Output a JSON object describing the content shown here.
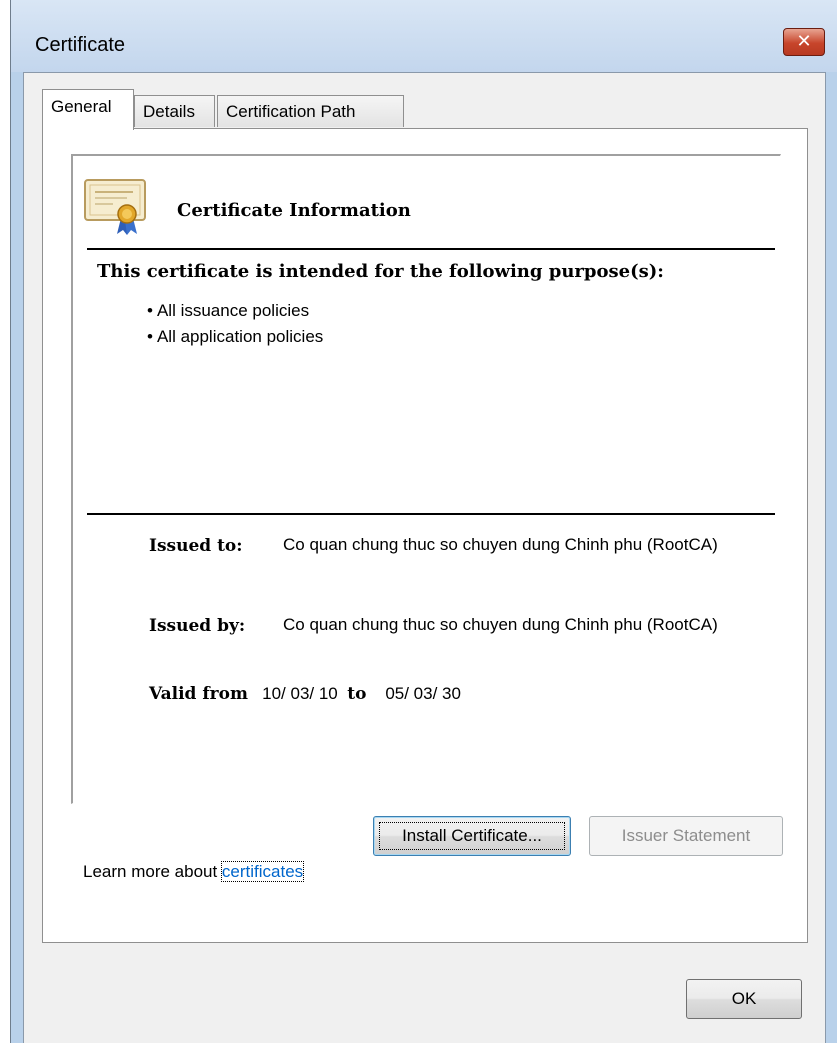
{
  "window": {
    "title": "Certificate",
    "close_glyph": "✕"
  },
  "tabs": [
    {
      "label": "General",
      "active": true
    },
    {
      "label": "Details",
      "active": false
    },
    {
      "label": "Certification Path",
      "active": false
    }
  ],
  "info": {
    "icon": "certificate-icon",
    "heading": "Certificate Information",
    "purpose_title": "This certificate is intended for the following purpose(s):",
    "purposes": [
      "All issuance policies",
      "All application policies"
    ],
    "issued_to_label": "Issued to:",
    "issued_to_value": "Co quan chung thuc so chuyen dung Chinh phu (RootCA)",
    "issued_by_label": "Issued by:",
    "issued_by_value": "Co quan chung thuc so chuyen dung Chinh phu (RootCA)",
    "valid_from_label": "Valid from",
    "valid_from": "10/ 03/ 10",
    "valid_to_label": "to",
    "valid_to": "05/ 03/ 30"
  },
  "buttons": {
    "install": "Install Certificate...",
    "issuer_statement": "Issuer Statement",
    "ok": "OK"
  },
  "learn_more": {
    "prefix": "Learn more about ",
    "link": "certificates"
  },
  "colors": {
    "link": "#0066cc",
    "close_button": "#c7452b",
    "title_bar": "#c3d6ed"
  }
}
